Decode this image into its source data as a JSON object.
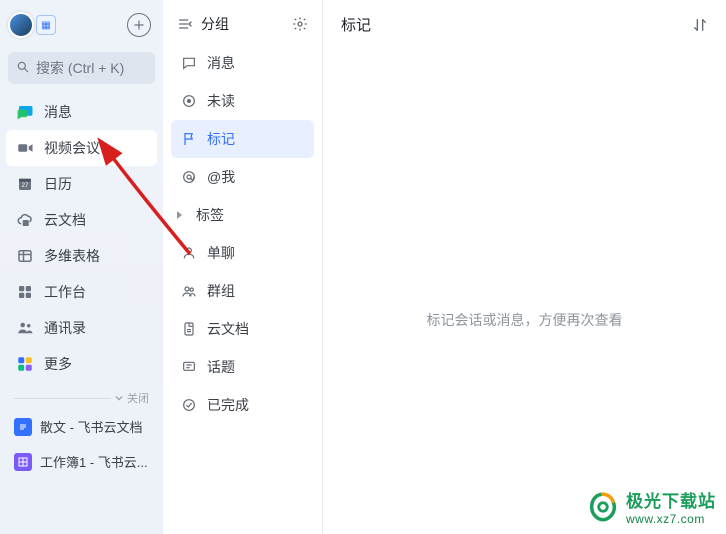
{
  "sidebar": {
    "search_placeholder": "搜索 (Ctrl + K)",
    "items": [
      {
        "label": "消息",
        "icon": "chat-icon"
      },
      {
        "label": "视频会议",
        "icon": "video-icon"
      },
      {
        "label": "日历",
        "icon": "calendar-icon"
      },
      {
        "label": "云文档",
        "icon": "cloud-doc-icon"
      },
      {
        "label": "多维表格",
        "icon": "grid-table-icon"
      },
      {
        "label": "工作台",
        "icon": "apps-icon"
      },
      {
        "label": "通讯录",
        "icon": "contacts-icon"
      },
      {
        "label": "更多",
        "icon": "more-icon"
      }
    ],
    "divider_label": "关闭",
    "docs": [
      {
        "label": "散文 - 飞书云文档",
        "badge": "doc-blue"
      },
      {
        "label": "工作簿1 - 飞书云...",
        "badge": "doc-purple"
      }
    ]
  },
  "mid": {
    "title": "分组",
    "items": [
      {
        "label": "消息",
        "icon": "chat-bubble-icon"
      },
      {
        "label": "未读",
        "icon": "unread-icon"
      },
      {
        "label": "标记",
        "icon": "flag-icon",
        "selected": true
      },
      {
        "label": "@我",
        "icon": "at-icon"
      },
      {
        "label": "标签",
        "icon": "tag-icon",
        "expandable": true
      },
      {
        "label": "单聊",
        "icon": "single-chat-icon"
      },
      {
        "label": "群组",
        "icon": "group-chat-icon"
      },
      {
        "label": "云文档",
        "icon": "doc-icon"
      },
      {
        "label": "话题",
        "icon": "topic-icon"
      },
      {
        "label": "已完成",
        "icon": "done-icon"
      }
    ]
  },
  "right": {
    "title": "标记",
    "empty": "标记会话或消息，方便再次查看"
  },
  "watermark": {
    "line1": "极光下载站",
    "line2": "www.xz7.com"
  }
}
